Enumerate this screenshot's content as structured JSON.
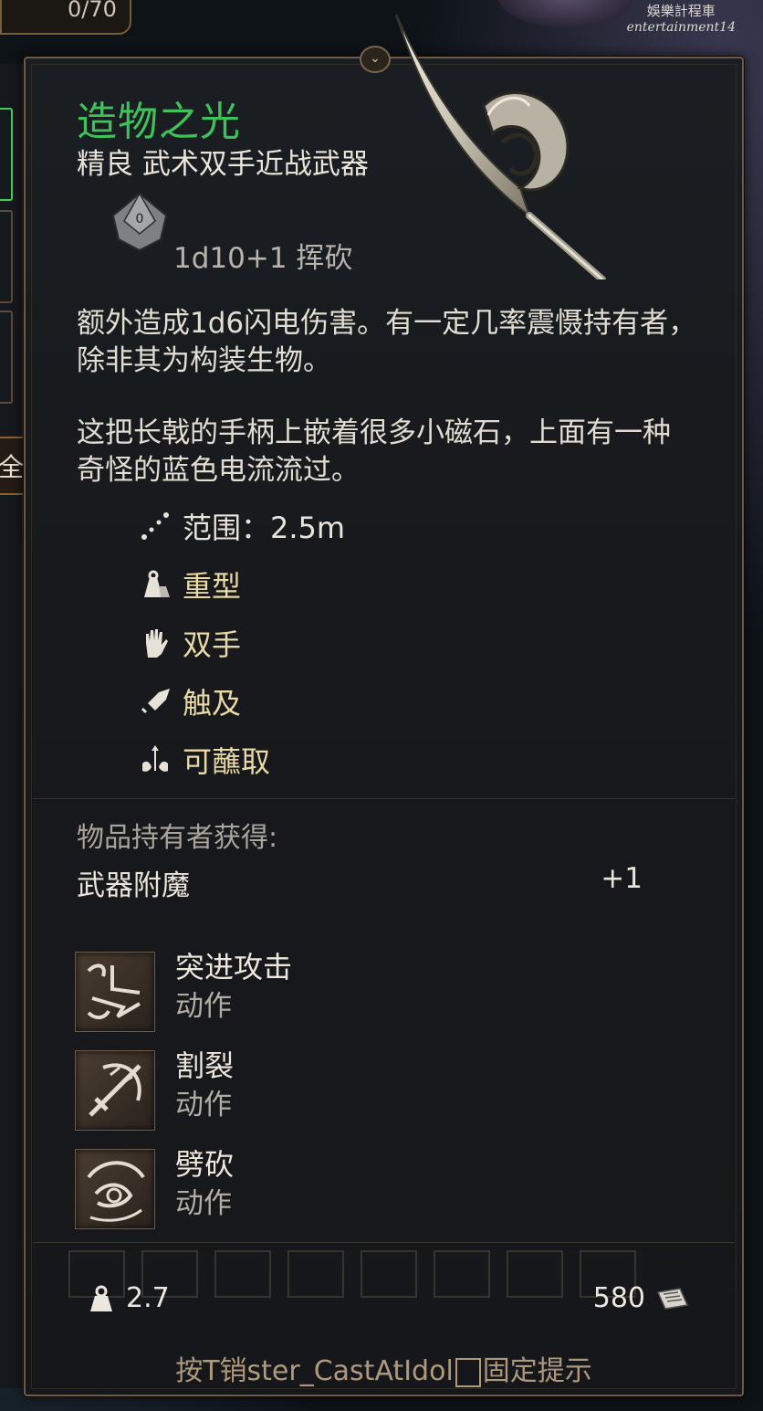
{
  "background": {
    "counter": "0/70",
    "filter_label": "全",
    "watermark_line1": "娛樂計程車",
    "watermark_line2": "entertainment14"
  },
  "tooltip": {
    "item_name": "造物之光",
    "item_subtitle": "精良 武术双手近战武器",
    "damage": "1d10+1 挥砍",
    "description_1": "额外造成1d6闪电伤害。有一定几率震慑持有者，除非其为构装生物。",
    "description_2": "这把长戟的手柄上嵌着很多小磁石，上面有一种奇怪的蓝色电流流过。",
    "properties": [
      {
        "icon": "range-icon",
        "label": "范围：2.5m"
      },
      {
        "icon": "heavy-icon",
        "label": "重型"
      },
      {
        "icon": "two-handed-icon",
        "label": "双手"
      },
      {
        "icon": "reach-icon",
        "label": "触及"
      },
      {
        "icon": "dippable-icon",
        "label": "可蘸取"
      }
    ],
    "grants_title": "物品持有者获得:",
    "grant": {
      "name": "武器附魔",
      "value": "+1"
    },
    "actions": [
      {
        "name": "突进攻击",
        "type": "动作",
        "icon": "lacerate-icon"
      },
      {
        "name": "割裂",
        "type": "动作",
        "icon": "rush-attack-icon"
      },
      {
        "name": "劈砍",
        "type": "动作",
        "icon": "cleave-icon"
      }
    ],
    "weight": "2.7",
    "price": "580",
    "hint_prefix": "按T销",
    "hint_middle": "ster_CastAtIdol",
    "hint_suffix": "固定提示"
  },
  "colors": {
    "item_name": "#3fc25a",
    "property_text": "#e9d9a6",
    "border": "#6e5a42"
  }
}
